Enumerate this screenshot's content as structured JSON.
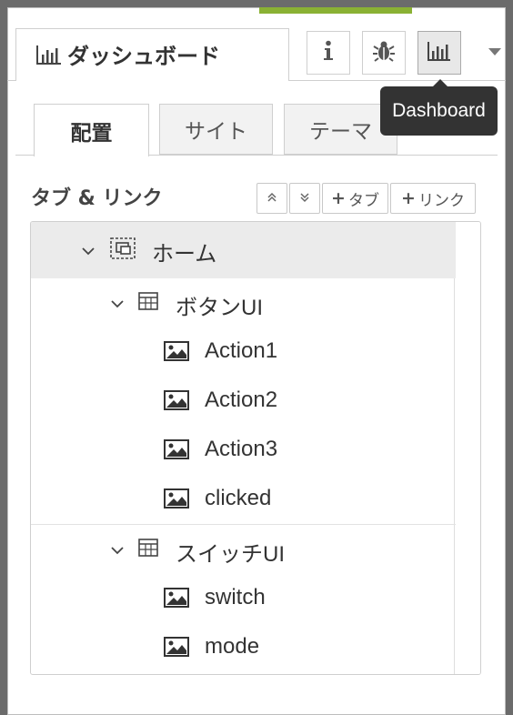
{
  "header": {
    "tab_label": "ダッシュボード",
    "buttons": [
      {
        "name": "info-button",
        "icon": "info-icon"
      },
      {
        "name": "debug-button",
        "icon": "bug-icon"
      },
      {
        "name": "dashboard-button",
        "icon": "bar-chart-icon"
      }
    ],
    "tooltip": "Dashboard"
  },
  "subtabs": [
    "配置",
    "サイト",
    "テーマ"
  ],
  "section": {
    "title": "タブ & リンク",
    "buttons": {
      "up": "⌃",
      "down": "⌄",
      "add_tab": "タブ",
      "add_link": "リンク"
    }
  },
  "tree": {
    "tab": "ホーム",
    "groups": [
      {
        "label": "ボタンUI",
        "widgets": [
          "Action1",
          "Action2",
          "Action3",
          "clicked"
        ]
      },
      {
        "label": "スイッチUI",
        "widgets": [
          "switch",
          "mode"
        ]
      }
    ]
  },
  "colors": {
    "accent": "#8ab134",
    "tooltip_bg": "#333333",
    "selected_row": "#ebebeb"
  }
}
